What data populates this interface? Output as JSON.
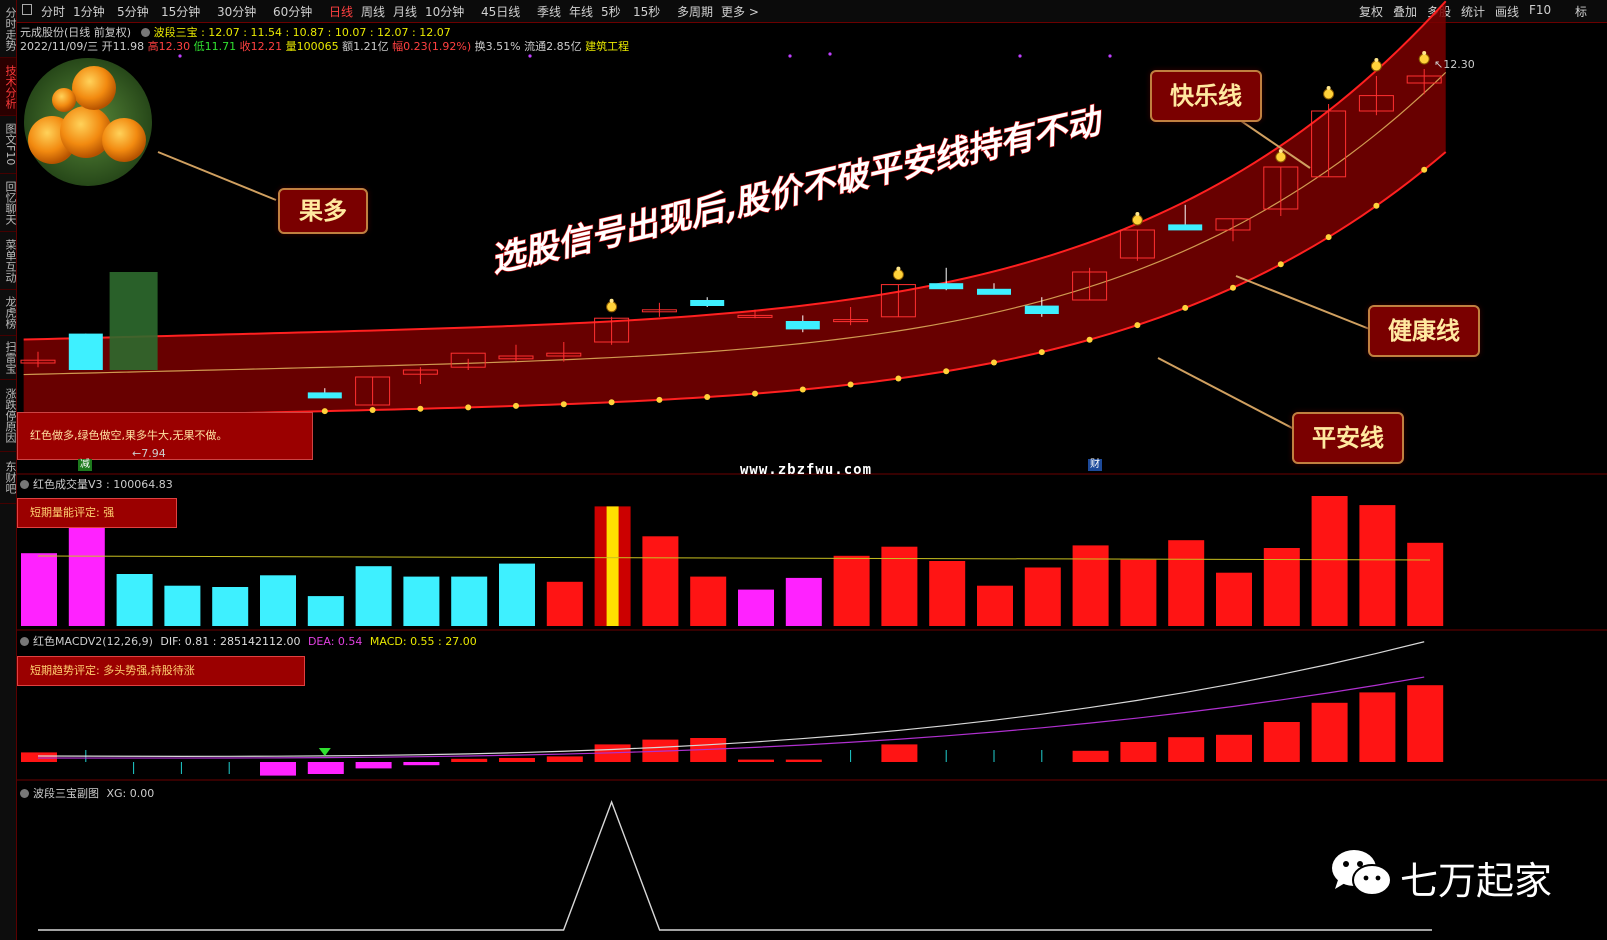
{
  "left_tabs": [
    "分时走势",
    "技术分析",
    "图文F10",
    "回忆聊天",
    "菜单互动",
    "龙虎榜",
    "扫雷宝",
    "涨跌停原因",
    "东财吧"
  ],
  "left_tab_active": 1,
  "periods": [
    "分时",
    "1分钟",
    "5分钟",
    "15分钟",
    "30分钟",
    "60分钟",
    "日线",
    "周线",
    "月线",
    "10分钟",
    "45日线",
    "季线",
    "年线",
    "5秒",
    "15秒",
    "多周期",
    "更多 >"
  ],
  "period_selected": "日线",
  "right_buttons": [
    "复权",
    "叠加",
    "多股",
    "统计",
    "画线",
    "F10",
    "标"
  ],
  "main_info": {
    "title": "元成股份(日线 前复权)",
    "indicator": "波段三宝 : 12.07 : 11.54 : 10.87 : 10.07 : 12.07 : 12.07",
    "line2": {
      "date": "2022/11/09/三",
      "open": "开11.98",
      "high": "高12.30",
      "low": "低11.71",
      "close": "收12.21",
      "vol": "量100065",
      "amt": "额1.21亿",
      "chg": "幅0.23(1.92%)",
      "turnover": "换3.51%",
      "float": "流通2.85亿",
      "sector": "建筑工程"
    }
  },
  "price_labels": {
    "high_marker": "12.30",
    "low_marker": "7.94"
  },
  "annotation_main": "选股信号出现后,股价不破平安线持有不动",
  "callouts": {
    "guoduo": "果多",
    "kuaile": "快乐线",
    "jiankang": "健康线",
    "pingan": "平安线"
  },
  "legend_box": "红色做多,绿色做空,果多牛大,无果不做。",
  "watermark": "www.zbzfwu.com",
  "event_markers": {
    "left": "减",
    "right": "财"
  },
  "volume_panel": {
    "title": "红色成交量V3 : 100064.83",
    "eval": "短期量能评定: 强",
    "bars": [
      {
        "v": 0.56,
        "c": "magenta"
      },
      {
        "v": 0.78,
        "c": "magenta"
      },
      {
        "v": 0.4,
        "c": "cyan"
      },
      {
        "v": 0.31,
        "c": "cyan"
      },
      {
        "v": 0.3,
        "c": "cyan"
      },
      {
        "v": 0.39,
        "c": "cyan"
      },
      {
        "v": 0.23,
        "c": "cyan"
      },
      {
        "v": 0.46,
        "c": "cyan"
      },
      {
        "v": 0.38,
        "c": "cyan"
      },
      {
        "v": 0.38,
        "c": "cyan"
      },
      {
        "v": 0.48,
        "c": "cyan"
      },
      {
        "v": 0.34,
        "c": "red"
      },
      {
        "v": 0.92,
        "c": "signal"
      },
      {
        "v": 0.69,
        "c": "red"
      },
      {
        "v": 0.38,
        "c": "red"
      },
      {
        "v": 0.28,
        "c": "magenta"
      },
      {
        "v": 0.37,
        "c": "magenta"
      },
      {
        "v": 0.54,
        "c": "red"
      },
      {
        "v": 0.61,
        "c": "red"
      },
      {
        "v": 0.5,
        "c": "red"
      },
      {
        "v": 0.31,
        "c": "red"
      },
      {
        "v": 0.45,
        "c": "red"
      },
      {
        "v": 0.62,
        "c": "red"
      },
      {
        "v": 0.51,
        "c": "red"
      },
      {
        "v": 0.66,
        "c": "red"
      },
      {
        "v": 0.41,
        "c": "red"
      },
      {
        "v": 0.6,
        "c": "red"
      },
      {
        "v": 1.0,
        "c": "red"
      },
      {
        "v": 0.93,
        "c": "red"
      },
      {
        "v": 0.64,
        "c": "red"
      }
    ]
  },
  "macd_panel": {
    "title": "红色MACDV2(12,26,9)",
    "dif": "DIF: 0.81 : 285142112.00",
    "dea": "DEA: 0.54",
    "macd": "MACD: 0.55 : 27.00",
    "eval": "短期趋势评定: 多头势强,持股待涨",
    "hist": [
      0.12,
      0.02,
      -0.02,
      -0.02,
      -0.02,
      -0.17,
      -0.15,
      -0.08,
      -0.04,
      0.04,
      0.05,
      0.07,
      0.22,
      0.28,
      0.3,
      0.03,
      0.03,
      0.02,
      0.22,
      0.02,
      0.02,
      0.02,
      0.14,
      0.25,
      0.31,
      0.34,
      0.5,
      0.74,
      0.87,
      0.96
    ]
  },
  "xg_panel": {
    "title": "波段三宝副图",
    "xg": "XG: 0.00",
    "signal_index": 12
  },
  "brand": {
    "name": "七万起家"
  },
  "candles": [
    {
      "o": 0.05,
      "h": 0.13,
      "l": 0.02,
      "c": 0.07,
      "col": "red"
    },
    {
      "o": 0.26,
      "h": 0.26,
      "l": 0.0,
      "c": 0.0,
      "col": "cyan"
    },
    {
      "o": 0.7,
      "h": 1.03,
      "l": 0.0,
      "c": 0.0,
      "col": "green"
    },
    {
      "o": 0.0,
      "h": 0.0,
      "l": 0.0,
      "c": 0.0,
      "col": "none"
    },
    {
      "o": 0.0,
      "h": 0.0,
      "l": 0.0,
      "c": 0.0,
      "col": "none"
    },
    {
      "o": 0.0,
      "h": 0.0,
      "l": 0.0,
      "c": 0.0,
      "col": "none"
    },
    {
      "o": -0.16,
      "h": -0.13,
      "l": -0.19,
      "c": -0.19,
      "col": "cyan"
    },
    {
      "o": -0.25,
      "h": -0.05,
      "l": -0.25,
      "c": -0.05,
      "col": "red"
    },
    {
      "o": -0.03,
      "h": 0.02,
      "l": -0.1,
      "c": 0.0,
      "col": "red"
    },
    {
      "o": 0.02,
      "h": 0.08,
      "l": 0.0,
      "c": 0.12,
      "col": "red"
    },
    {
      "o": 0.08,
      "h": 0.18,
      "l": 0.06,
      "c": 0.1,
      "col": "red"
    },
    {
      "o": 0.1,
      "h": 0.2,
      "l": 0.06,
      "c": 0.12,
      "col": "red"
    },
    {
      "o": 0.2,
      "h": 0.38,
      "l": 0.18,
      "c": 0.37,
      "col": "red"
    },
    {
      "o": 0.43,
      "h": 0.48,
      "l": 0.38,
      "c": 0.43,
      "col": "red"
    },
    {
      "o": 0.5,
      "h": 0.52,
      "l": 0.45,
      "c": 0.46,
      "col": "cyan"
    },
    {
      "o": 0.39,
      "h": 0.43,
      "l": 0.37,
      "c": 0.39,
      "col": "red"
    },
    {
      "o": 0.35,
      "h": 0.39,
      "l": 0.27,
      "c": 0.29,
      "col": "cyan"
    },
    {
      "o": 0.36,
      "h": 0.45,
      "l": 0.32,
      "c": 0.36,
      "col": "red"
    },
    {
      "o": 0.38,
      "h": 0.61,
      "l": 0.38,
      "c": 0.61,
      "col": "red"
    },
    {
      "o": 0.62,
      "h": 0.73,
      "l": 0.57,
      "c": 0.61,
      "col": "cyan"
    },
    {
      "o": 0.58,
      "h": 0.62,
      "l": 0.55,
      "c": 0.58,
      "col": "cyan"
    },
    {
      "o": 0.46,
      "h": 0.52,
      "l": 0.38,
      "c": 0.4,
      "col": "cyan"
    },
    {
      "o": 0.5,
      "h": 0.73,
      "l": 0.5,
      "c": 0.7,
      "col": "red"
    },
    {
      "o": 0.8,
      "h": 1.0,
      "l": 0.78,
      "c": 1.0,
      "col": "red"
    },
    {
      "o": 1.03,
      "h": 1.18,
      "l": 1.01,
      "c": 1.04,
      "col": "cyan"
    },
    {
      "o": 1.0,
      "h": 1.08,
      "l": 0.92,
      "c": 1.08,
      "col": "red"
    },
    {
      "o": 1.15,
      "h": 1.45,
      "l": 1.1,
      "c": 1.45,
      "col": "red"
    },
    {
      "o": 1.38,
      "h": 1.9,
      "l": 1.38,
      "c": 1.85,
      "col": "red"
    },
    {
      "o": 1.85,
      "h": 2.1,
      "l": 1.82,
      "c": 1.96,
      "col": "red"
    },
    {
      "o": 2.05,
      "h": 2.15,
      "l": 1.97,
      "c": 2.1,
      "col": "red"
    }
  ],
  "colors": {
    "bg": "#000000",
    "band": "#7a0000",
    "line_red": "#ff2020",
    "cyan": "#3ef0ff",
    "magenta": "#ff22ff",
    "gold": "#ffd23a"
  }
}
